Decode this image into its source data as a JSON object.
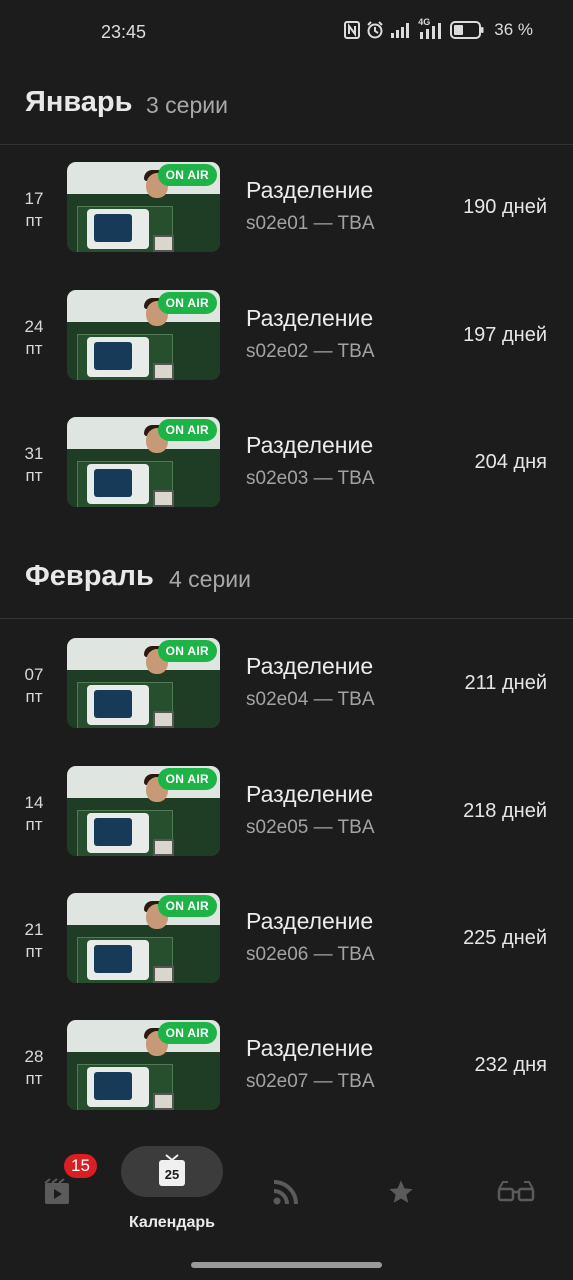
{
  "status_bar": {
    "time": "23:45",
    "battery_text": "36 %",
    "network_label": "4G",
    "icons": [
      "nfc-icon",
      "alarm-icon",
      "signal-icon",
      "signal-4g-icon",
      "battery-icon"
    ]
  },
  "months": [
    {
      "name": "Январь",
      "count": "3 серии",
      "episodes": [
        {
          "day": "17",
          "weekday": "пт",
          "title": "Разделение",
          "subtitle": "s02e01 — TBA",
          "days_left": "190 дней",
          "badge": "ON AIR"
        },
        {
          "day": "24",
          "weekday": "пт",
          "title": "Разделение",
          "subtitle": "s02e02 — TBA",
          "days_left": "197 дней",
          "badge": "ON AIR"
        },
        {
          "day": "31",
          "weekday": "пт",
          "title": "Разделение",
          "subtitle": "s02e03 — TBA",
          "days_left": "204 дня",
          "badge": "ON AIR"
        }
      ]
    },
    {
      "name": "Февраль",
      "count": "4 серии",
      "episodes": [
        {
          "day": "07",
          "weekday": "пт",
          "title": "Разделение",
          "subtitle": "s02e04 — TBA",
          "days_left": "211 дней",
          "badge": "ON AIR"
        },
        {
          "day": "14",
          "weekday": "пт",
          "title": "Разделение",
          "subtitle": "s02e05 — TBA",
          "days_left": "218 дней",
          "badge": "ON AIR"
        },
        {
          "day": "21",
          "weekday": "пт",
          "title": "Разделение",
          "subtitle": "s02e06 — TBA",
          "days_left": "225 дней",
          "badge": "ON AIR"
        },
        {
          "day": "28",
          "weekday": "пт",
          "title": "Разделение",
          "subtitle": "s02e07 — TBA",
          "days_left": "232 дня",
          "badge": "ON AIR"
        }
      ]
    }
  ],
  "bottom_nav": {
    "items": [
      {
        "icon": "episodes-icon",
        "badge": "15"
      },
      {
        "icon": "calendar-icon",
        "label": "Календарь",
        "active": true,
        "icon_text": "25"
      },
      {
        "icon": "feed-icon"
      },
      {
        "icon": "star-icon"
      },
      {
        "icon": "glasses-icon"
      }
    ]
  },
  "colors": {
    "background": "#1c1c1c",
    "on_air_badge": "#1db347",
    "notification_badge": "#d91f23",
    "active_pill": "#3c3c3c"
  }
}
